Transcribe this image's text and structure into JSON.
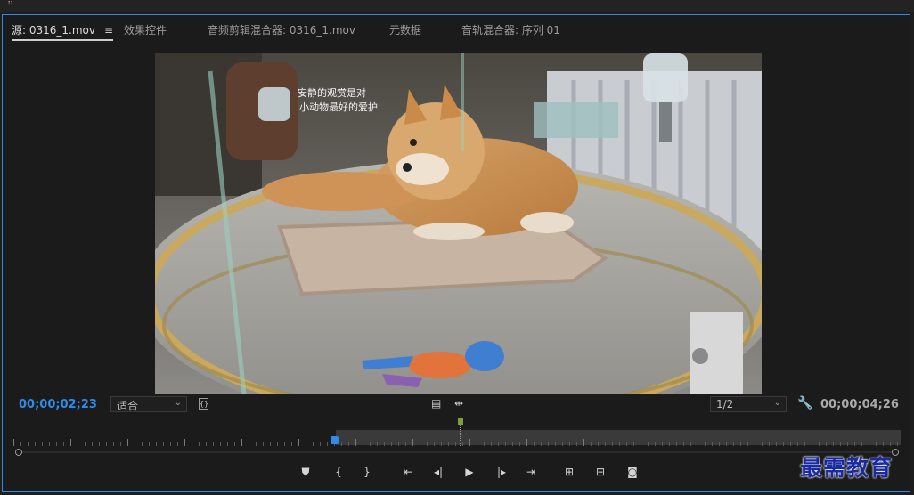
{
  "tabs": [
    {
      "label": "源: 0316_1.mov",
      "active": true
    },
    {
      "label": "效果控件"
    },
    {
      "label": "音频剪辑混合器: 0316_1.mov"
    },
    {
      "label": "元数据"
    },
    {
      "label": "音轨混合器: 序列 01"
    }
  ],
  "monitor": {
    "current_timecode": "00;00;02;23",
    "duration_timecode": "00;00;04;26",
    "zoom_select": "适合",
    "resolution_select": "1/2",
    "playhead_fraction": 0.365
  },
  "icons": {
    "panel_menu": "hamburger-icon",
    "settings": "wrench-icon",
    "export_frame": "camera-icon"
  },
  "image": {
    "sign_line1": "安静的观赏是对",
    "sign_line2": "小动物最好的爱护"
  },
  "watermark": "最需教育",
  "colors": {
    "accent": "#2d8ceb",
    "marker": "#7aa03a"
  }
}
